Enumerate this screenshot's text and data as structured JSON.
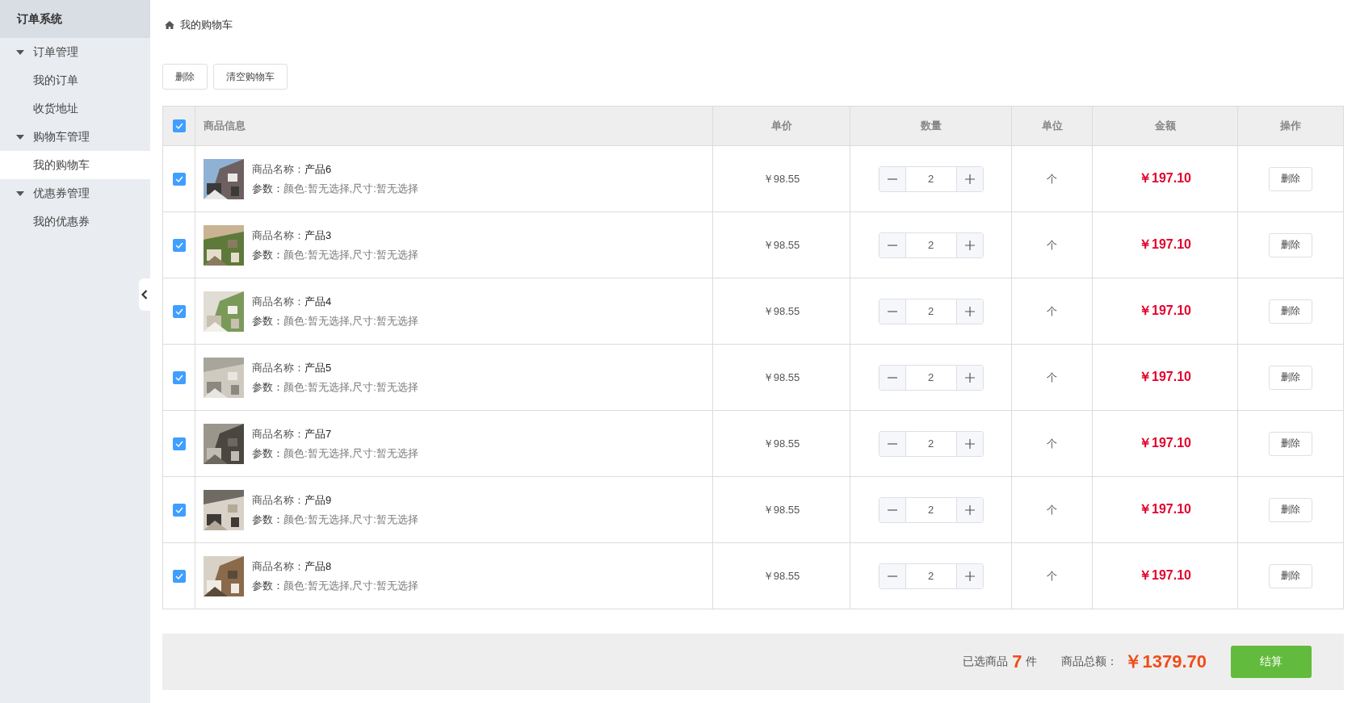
{
  "sidebar": {
    "title": "订单系统",
    "groups": [
      {
        "label": "订单管理",
        "expanded": true,
        "children": [
          {
            "label": "我的订单",
            "selected": false
          },
          {
            "label": "收货地址",
            "selected": false
          }
        ]
      },
      {
        "label": "购物车管理",
        "expanded": true,
        "children": [
          {
            "label": "我的购物车",
            "selected": true
          }
        ]
      },
      {
        "label": "优惠券管理",
        "expanded": true,
        "children": [
          {
            "label": "我的优惠券",
            "selected": false
          }
        ]
      }
    ]
  },
  "breadcrumb": "我的购物车",
  "toolbar": [
    "删除",
    "清空购物车"
  ],
  "table": {
    "all_selected": true,
    "columns": [
      "商品信息",
      "单价",
      "数量",
      "单位",
      "金额",
      "操作"
    ],
    "rows": [
      {
        "selected": true,
        "name_label": "商品名称：",
        "name": "产品6",
        "params_label": "参数：",
        "params": "颜色:暂无选择,尺寸:暂无选择",
        "price": "￥98.55",
        "quantity": "2",
        "unit": "个",
        "amount": "￥197.10",
        "action": "删除"
      },
      {
        "selected": true,
        "name_label": "商品名称：",
        "name": "产品3",
        "params_label": "参数：",
        "params": "颜色:暂无选择,尺寸:暂无选择",
        "price": "￥98.55",
        "quantity": "2",
        "unit": "个",
        "amount": "￥197.10",
        "action": "删除"
      },
      {
        "selected": true,
        "name_label": "商品名称：",
        "name": "产品4",
        "params_label": "参数：",
        "params": "颜色:暂无选择,尺寸:暂无选择",
        "price": "￥98.55",
        "quantity": "2",
        "unit": "个",
        "amount": "￥197.10",
        "action": "删除"
      },
      {
        "selected": true,
        "name_label": "商品名称：",
        "name": "产品5",
        "params_label": "参数：",
        "params": "颜色:暂无选择,尺寸:暂无选择",
        "price": "￥98.55",
        "quantity": "2",
        "unit": "个",
        "amount": "￥197.10",
        "action": "删除"
      },
      {
        "selected": true,
        "name_label": "商品名称：",
        "name": "产品7",
        "params_label": "参数：",
        "params": "颜色:暂无选择,尺寸:暂无选择",
        "price": "￥98.55",
        "quantity": "2",
        "unit": "个",
        "amount": "￥197.10",
        "action": "删除"
      },
      {
        "selected": true,
        "name_label": "商品名称：",
        "name": "产品9",
        "params_label": "参数：",
        "params": "颜色:暂无选择,尺寸:暂无选择",
        "price": "￥98.55",
        "quantity": "2",
        "unit": "个",
        "amount": "￥197.10",
        "action": "删除"
      },
      {
        "selected": true,
        "name_label": "商品名称：",
        "name": "产品8",
        "params_label": "参数：",
        "params": "颜色:暂无选择,尺寸:暂无选择",
        "price": "￥98.55",
        "quantity": "2",
        "unit": "个",
        "amount": "￥197.10",
        "action": "删除"
      }
    ]
  },
  "footer": {
    "selected_prefix": "已选商品",
    "selected_count": "7",
    "selected_suffix": "件",
    "total_label": "商品总额：",
    "total": "￥1379.70",
    "checkout": "结算"
  }
}
